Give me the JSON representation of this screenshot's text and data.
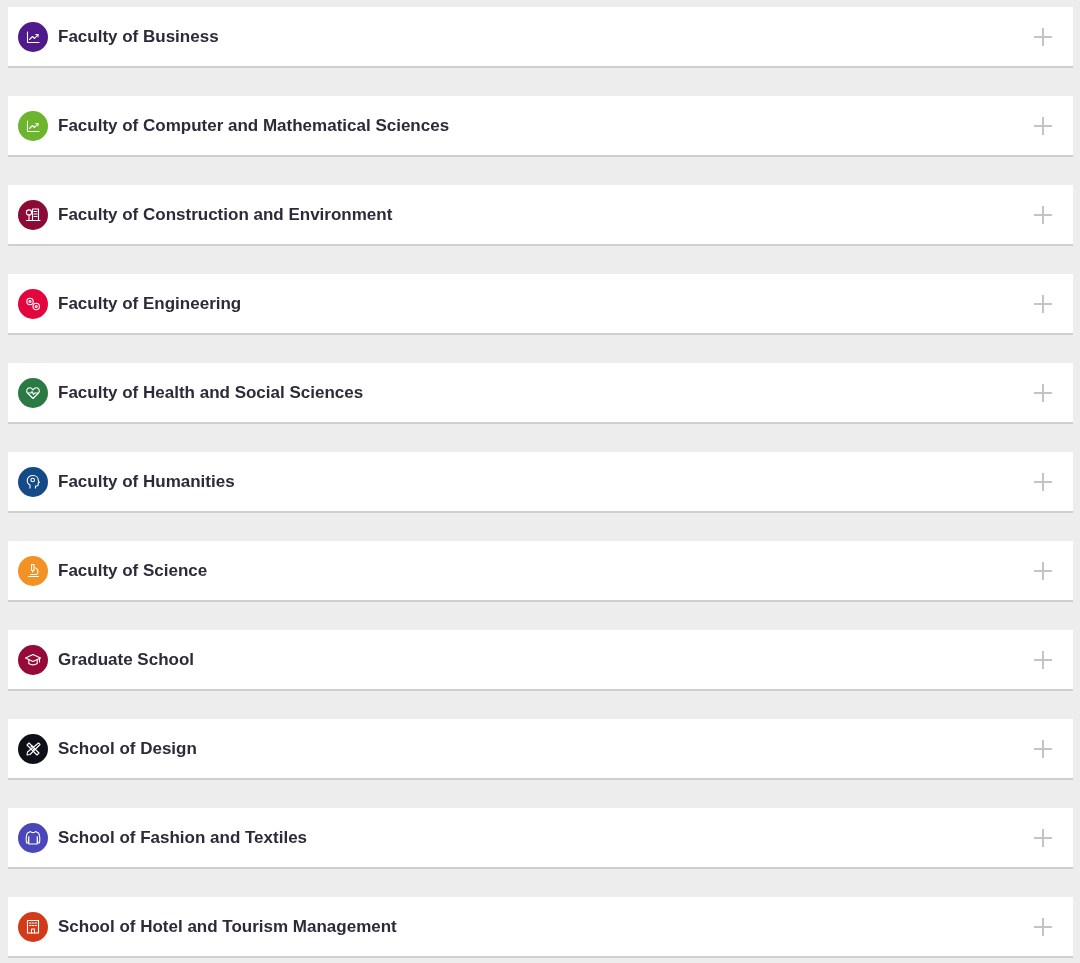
{
  "faculties": [
    {
      "name": "Faculty of Business",
      "color": "#4f1a8c",
      "expanded": false
    },
    {
      "name": "Faculty of Computer and Mathematical Sciences",
      "color": "#6cb52d",
      "expanded": false
    },
    {
      "name": "Faculty of Construction and Environment",
      "color": "#8c0b35",
      "expanded": false
    },
    {
      "name": "Faculty of Engineering",
      "color": "#e3063d",
      "expanded": false
    },
    {
      "name": "Faculty of Health and Social Sciences",
      "color": "#2b7a44",
      "expanded": false
    },
    {
      "name": "Faculty of Humanities",
      "color": "#144b86",
      "expanded": false
    },
    {
      "name": "Faculty of Science",
      "color": "#f39224",
      "expanded": false
    },
    {
      "name": "Graduate School",
      "color": "#960a3a",
      "expanded": false
    },
    {
      "name": "School of Design",
      "color": "#0d1117",
      "expanded": false
    },
    {
      "name": "School of Fashion and Textiles",
      "color": "#4b46b9",
      "expanded": false
    },
    {
      "name": "School of Hotel and Tourism Management",
      "color": "#d33a19",
      "expanded": false
    }
  ]
}
